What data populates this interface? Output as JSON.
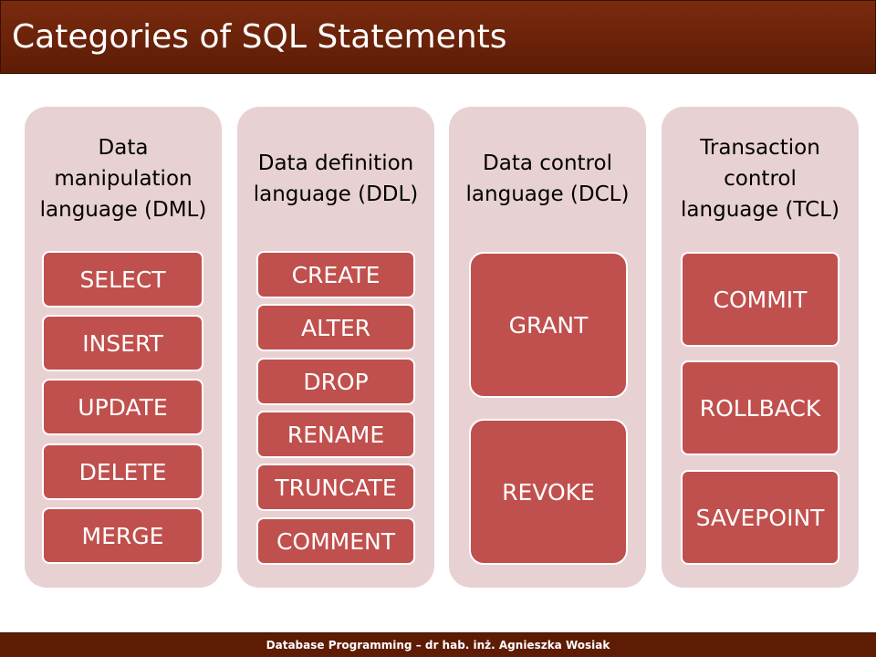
{
  "slide": {
    "title": "Categories of SQL Statements",
    "footer": "Database Programming – dr hab. inż. Agnieszka Wosiak"
  },
  "colors": {
    "title_bar": "#5e1c05",
    "column_bg": "#e8d1d3",
    "command_box": "#c0504d",
    "command_text": "#ffffff"
  },
  "categories": [
    {
      "header_lines": [
        "Data",
        "manipulation",
        "language (DML)"
      ],
      "commands": [
        "SELECT",
        "INSERT",
        "UPDATE",
        "DELETE",
        "MERGE"
      ]
    },
    {
      "header_lines": [
        "Data definition",
        "language (DDL)"
      ],
      "commands": [
        "CREATE",
        "ALTER",
        "DROP",
        "RENAME",
        "TRUNCATE",
        "COMMENT"
      ]
    },
    {
      "header_lines": [
        "Data control",
        "language (DCL)"
      ],
      "commands": [
        "GRANT",
        "REVOKE"
      ]
    },
    {
      "header_lines": [
        "Transaction",
        "control",
        "language (TCL)"
      ],
      "commands": [
        "COMMIT",
        "ROLLBACK",
        "SAVEPOINT"
      ]
    }
  ]
}
